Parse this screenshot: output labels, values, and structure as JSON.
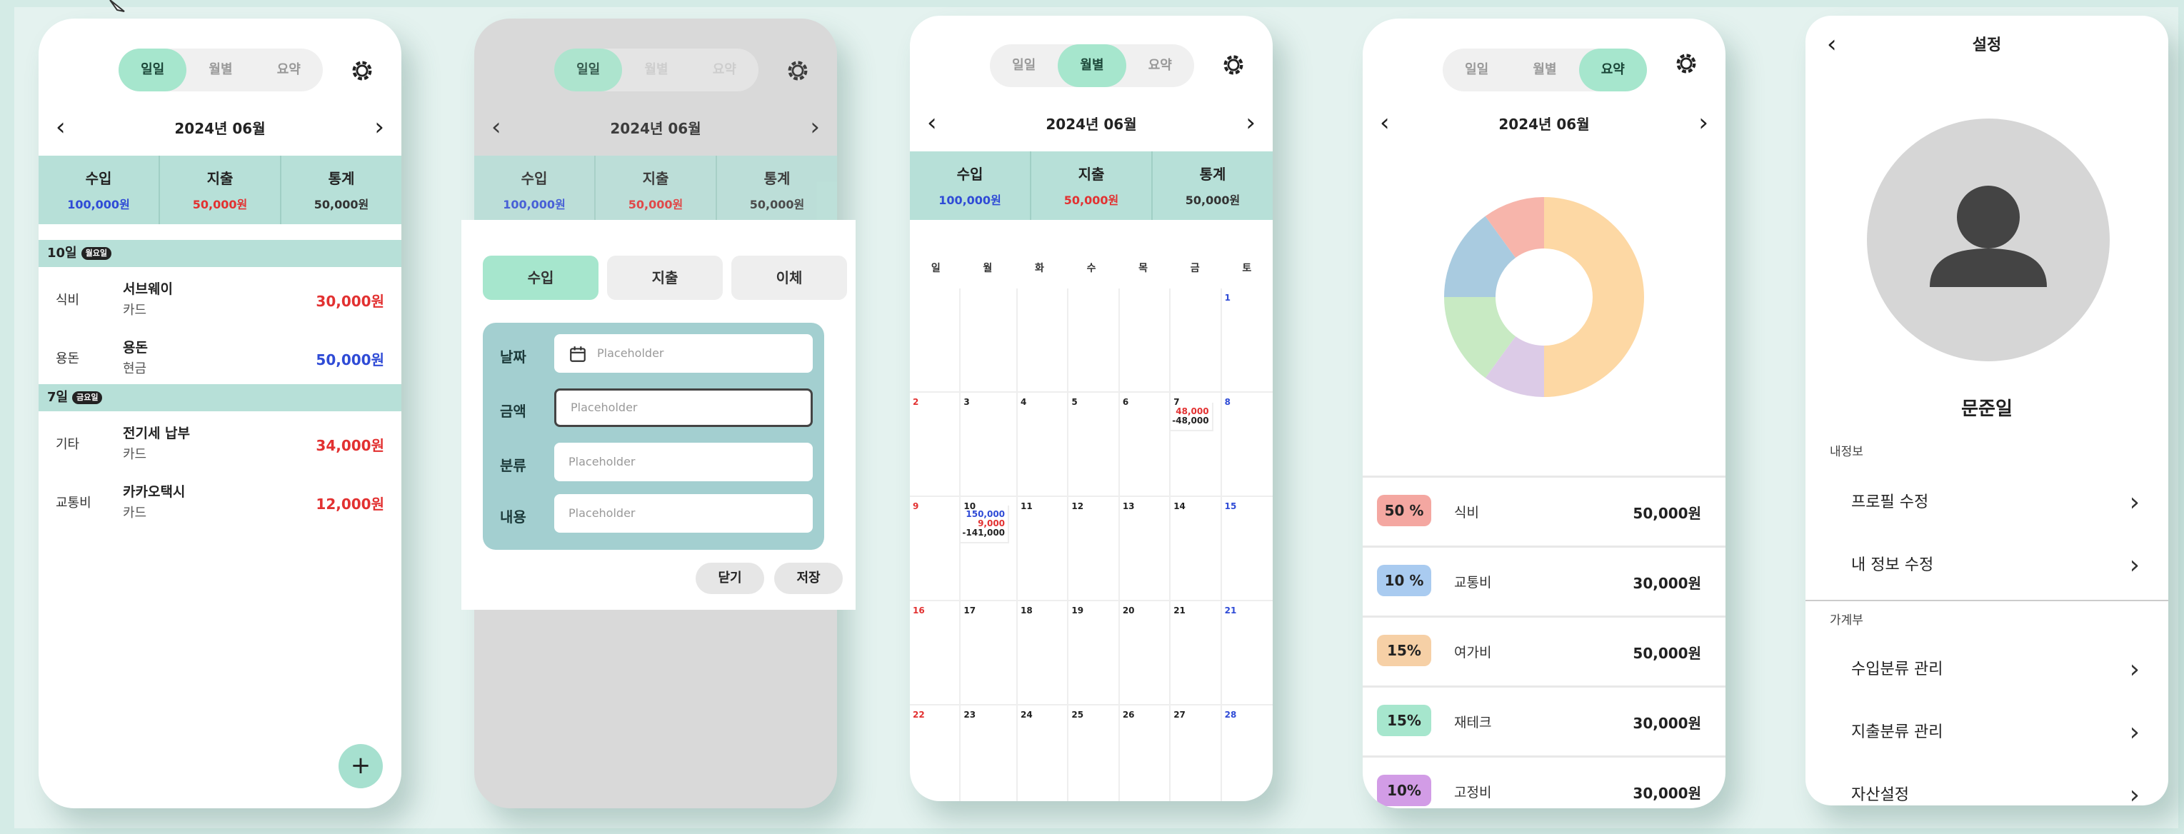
{
  "colors": {
    "accent": "#a6e6cd",
    "income": "#2f4bd6",
    "expense": "#e23131",
    "summary_bg": "#b7e0d8",
    "form_bg": "#a3cfd0"
  },
  "tabs": {
    "daily": "일일",
    "monthly": "월별",
    "summary": "요약"
  },
  "month": "2024년 06월",
  "summary_bar": {
    "income_label": "수입",
    "income_value": "100,000원",
    "expense_label": "지출",
    "expense_value": "50,000원",
    "total_label": "통계",
    "total_value": "50,000원"
  },
  "daily": {
    "groups": [
      {
        "day": "10일",
        "weekday": "월요일",
        "items": [
          {
            "category": "식비",
            "name": "서브웨이",
            "payment": "카드",
            "amount": "30,000원",
            "type": "expense"
          },
          {
            "category": "용돈",
            "name": "용돈",
            "payment": "현금",
            "amount": "50,000원",
            "type": "income"
          }
        ]
      },
      {
        "day": "7일",
        "weekday": "금요일",
        "items": [
          {
            "category": "기타",
            "name": "전기세 납부",
            "payment": "카드",
            "amount": "34,000원",
            "type": "expense"
          },
          {
            "category": "교통비",
            "name": "카카오택시",
            "payment": "카드",
            "amount": "12,000원",
            "type": "expense"
          }
        ]
      }
    ],
    "fab": "+"
  },
  "modal": {
    "tabs": [
      "수입",
      "지출",
      "이체"
    ],
    "fields": [
      {
        "label": "날짜",
        "placeholder": "Placeholder"
      },
      {
        "label": "금액",
        "placeholder": "Placeholder"
      },
      {
        "label": "분류",
        "placeholder": "Placeholder"
      },
      {
        "label": "내용",
        "placeholder": "Placeholder"
      }
    ],
    "close": "닫기",
    "save": "저장"
  },
  "calendar": {
    "weekdays": [
      "일",
      "월",
      "화",
      "수",
      "목",
      "금",
      "토"
    ],
    "weeks": [
      [
        "",
        "",
        "",
        "",
        "",
        "",
        "1"
      ],
      [
        "2",
        "3",
        "4",
        "5",
        "6",
        "7",
        "8"
      ],
      [
        "9",
        "10",
        "11",
        "12",
        "13",
        "14",
        "15"
      ],
      [
        "16",
        "17",
        "18",
        "19",
        "20",
        "21",
        "21"
      ],
      [
        "22",
        "23",
        "24",
        "25",
        "26",
        "27",
        "28"
      ]
    ],
    "day7": {
      "income": "48,000",
      "net": "-48,000"
    },
    "day10": {
      "income": "150,000",
      "expense": "9,000",
      "net": "-141,000"
    }
  },
  "summary": {
    "chart_data": {
      "type": "pie",
      "values": [
        50,
        10,
        15,
        15,
        10
      ],
      "labels": [
        "식비",
        "교통비",
        "여가비",
        "재테크",
        "고정비"
      ],
      "colors": [
        "#fdd8a4",
        "#dccbe7",
        "#c8eac3",
        "#a9cbe0",
        "#f7b5ab"
      ]
    },
    "items": [
      {
        "pct": "50 %",
        "name": "식비",
        "amount": "50,000원",
        "color": "#f4a7a1"
      },
      {
        "pct": "10 %",
        "name": "교통비",
        "amount": "30,000원",
        "color": "#a9cbf0"
      },
      {
        "pct": "15%",
        "name": "여가비",
        "amount": "50,000원",
        "color": "#f6d0a6"
      },
      {
        "pct": "15%",
        "name": "재테크",
        "amount": "30,000원",
        "color": "#a6e6cd"
      },
      {
        "pct": "10%",
        "name": "고정비",
        "amount": "30,000원",
        "color": "#d29ce6"
      }
    ]
  },
  "settings": {
    "title": "설정",
    "user": "문준일",
    "section1": "내정보",
    "profile_edit": "프로필 수정",
    "info_edit": "내 정보 수정",
    "section2": "가계부",
    "income_cat": "수입분류 관리",
    "expense_cat": "지출분류 관리",
    "asset": "자산설정"
  }
}
